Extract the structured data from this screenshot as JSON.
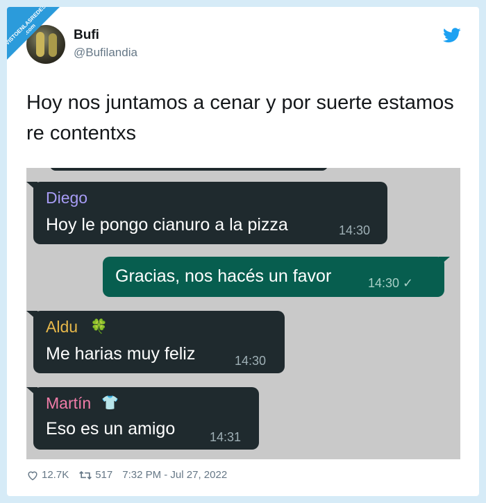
{
  "watermark": {
    "text": "VISTOENLASREDES .com"
  },
  "author": {
    "name": "Bufi",
    "handle": "@Bufilandia"
  },
  "tweet": {
    "text": "Hoy nos juntamos a cenar y por suerte estamos re contentxs"
  },
  "chat": {
    "messages": [
      {
        "sender": "Diego",
        "text": "Hoy le pongo cianuro a la pizza",
        "time": "14:30",
        "direction": "in",
        "sender_color": "#a79cf5"
      },
      {
        "text": "Gracias, nos hacés un favor",
        "time": "14:30 ✓",
        "direction": "out"
      },
      {
        "sender": "Aldu",
        "emoji": "🍀",
        "text": "Me harias muy feliz",
        "time": "14:30",
        "direction": "in",
        "sender_color": "#e7b84a"
      },
      {
        "sender": "Martín",
        "emoji": "👕",
        "text": "Eso es un amigo",
        "time": "14:31",
        "direction": "in",
        "sender_color": "#f07ca8"
      }
    ]
  },
  "stats": {
    "likes": "12.7K",
    "retweets": "517",
    "timestamp": "7:32 PM - Jul 27, 2022"
  },
  "icons": {
    "bird": "twitter-bird-icon",
    "heart": "heart-icon",
    "retweet": "retweet-icon"
  },
  "colors": {
    "twitter_blue": "#1da1f2",
    "incoming_bubble": "#1f2a2e",
    "outgoing_bubble": "#075e4f"
  }
}
